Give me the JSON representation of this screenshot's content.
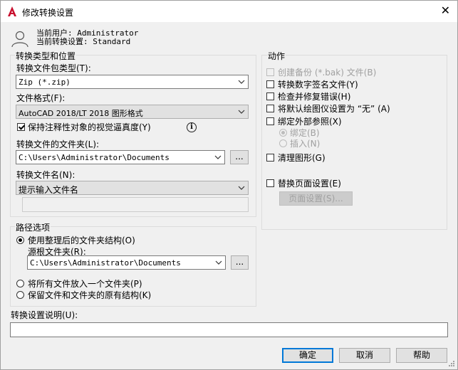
{
  "window": {
    "title": "修改转换设置",
    "close_glyph": "✕"
  },
  "user_info": {
    "current_user": "当前用户: Administrator",
    "current_setting": "当前转换设置: Standard"
  },
  "type_location": {
    "group_label": "转换类型和位置",
    "package_type_label": "转换文件包类型(T):",
    "package_type_value": "Zip (*.zip)",
    "file_format_label": "文件格式(F):",
    "file_format_value": "AutoCAD 2018/LT 2018 图形格式",
    "keep_annotative_label": "保持注释性对象的视觉逼真度(Y)",
    "keep_annotative_checked": true,
    "folder_label": "转换文件的文件夹(L):",
    "folder_value": "C:\\Users\\Administrator\\Documents",
    "browse_label": "...",
    "file_name_label": "转换文件名(N):",
    "file_name_value": "提示输入文件名",
    "file_name_input": ""
  },
  "path_options": {
    "group_label": "路径选项",
    "use_organized_label": "使用整理后的文件夹结构(O)",
    "use_organized_selected": true,
    "source_root_label": "源根文件夹(R):",
    "source_root_value": "C:\\Users\\Administrator\\Documents",
    "browse_label": "...",
    "single_folder_label": "将所有文件放入一个文件夹(P)",
    "keep_structure_label": "保留文件和文件夹的原有结构(K)"
  },
  "actions": {
    "group_label": "动作",
    "create_backup_label": "创建备份 (*.bak) 文件(B)",
    "digital_signature_label": "转换数字签名文件(Y)",
    "audit_label": "检查并修复错误(H)",
    "default_plotter_label": "将默认绘图仪设置为 “无” (A)",
    "bind_xrefs_label": "绑定外部参照(X)",
    "bind_label": "绑定(B)",
    "insert_label": "插入(N)",
    "purge_label": "清理图形(G)",
    "replace_page_setup_label": "替换页面设置(E)",
    "page_setup_button": "页面设置(S)..."
  },
  "description": {
    "label": "转换设置说明(U):",
    "value": ""
  },
  "footer": {
    "ok": "确定",
    "cancel": "取消",
    "help": "帮助"
  },
  "colors": {
    "accent": "#0078d7",
    "app_icon_red": "#c8102e"
  }
}
